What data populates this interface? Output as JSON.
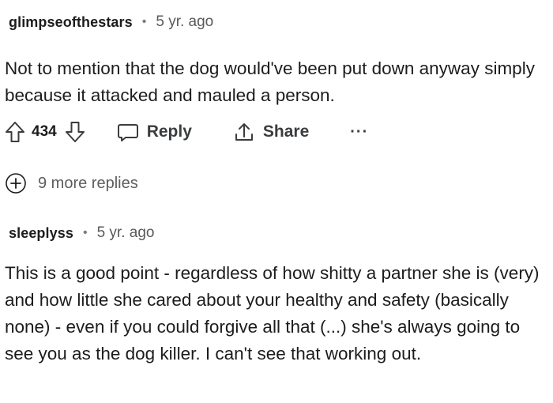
{
  "comments": [
    {
      "author": "glimpseofthestars",
      "separator": "•",
      "age": "5 yr. ago",
      "text": "Not to mention that the dog would've been put down anyway simply because it attacked and mauled a person.",
      "votes": "434",
      "actions": {
        "reply_label": "Reply",
        "share_label": "Share",
        "more_label": "···"
      },
      "more_replies_label": "9 more replies"
    },
    {
      "author": "sleeplyss",
      "separator": "•",
      "age": "5 yr. ago",
      "text": "This is a good point - regardless of how shitty a partner she is (very) and how little she cared about your healthy and safety (basically none) - even if you could forgive all that (...) she's always going to see you as the dog killer. I can't see that working out."
    }
  ],
  "icons": {
    "upvote": "upvote-arrow-icon",
    "downvote": "downvote-arrow-icon",
    "reply": "speech-bubble-icon",
    "share": "share-upload-icon",
    "expand": "plus-circle-icon"
  },
  "colors": {
    "text": "#1c1c1c",
    "muted": "#57595b",
    "icon": "#3a3c3e"
  }
}
